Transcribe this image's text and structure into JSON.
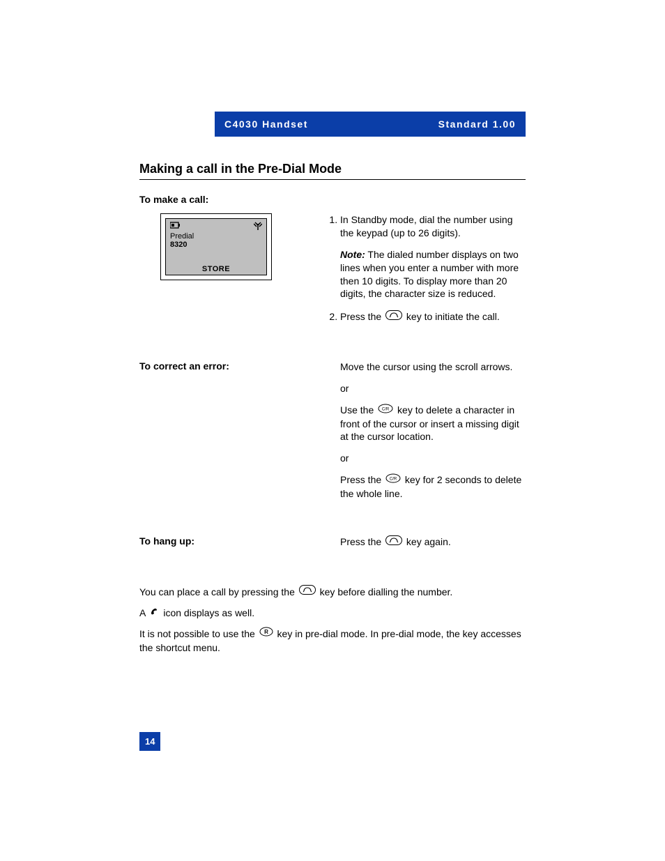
{
  "header": {
    "left": "C4030 Handset",
    "right": "Standard 1.00"
  },
  "title": "Making a call in the Pre-Dial Mode",
  "section_make_call": {
    "heading": "To make a call:",
    "device_screen": {
      "line1": "Predial",
      "line2": "8320",
      "softkey": "STORE"
    },
    "steps": [
      {
        "text": "In Standby mode, dial the number using the keypad (up to 26 digits)."
      }
    ],
    "note_label": "Note:",
    "note_text": "The dialed number displays on two lines when you enter a number with more then 10 digits. To display more than 20 digits, the character size is reduced.",
    "step2_pre": "Press the",
    "step2_post": "key to initiate the call."
  },
  "section_correct": {
    "heading": "To correct an error:",
    "para1": "Move the cursor using the scroll arrows.",
    "or": "or",
    "para2_pre": "Use the",
    "para2_post": "key to delete a character in front of the cursor or insert a missing digit at the cursor location.",
    "para3_pre": "Press the",
    "para3_post": "key for 2 seconds to delete the whole line."
  },
  "section_hangup": {
    "heading": "To hang up:",
    "text_pre": "Press the",
    "text_post": "key again."
  },
  "footer": {
    "p1_pre": "You can place a call by pressing the",
    "p1_post": "key before dialling the number.",
    "p2_pre": "A",
    "p2_post": "icon displays as well.",
    "p3_pre": "It is not possible to use the",
    "p3_post": "key in pre-dial mode. In pre-dial mode, the key accesses the shortcut menu."
  },
  "page_number": "14"
}
